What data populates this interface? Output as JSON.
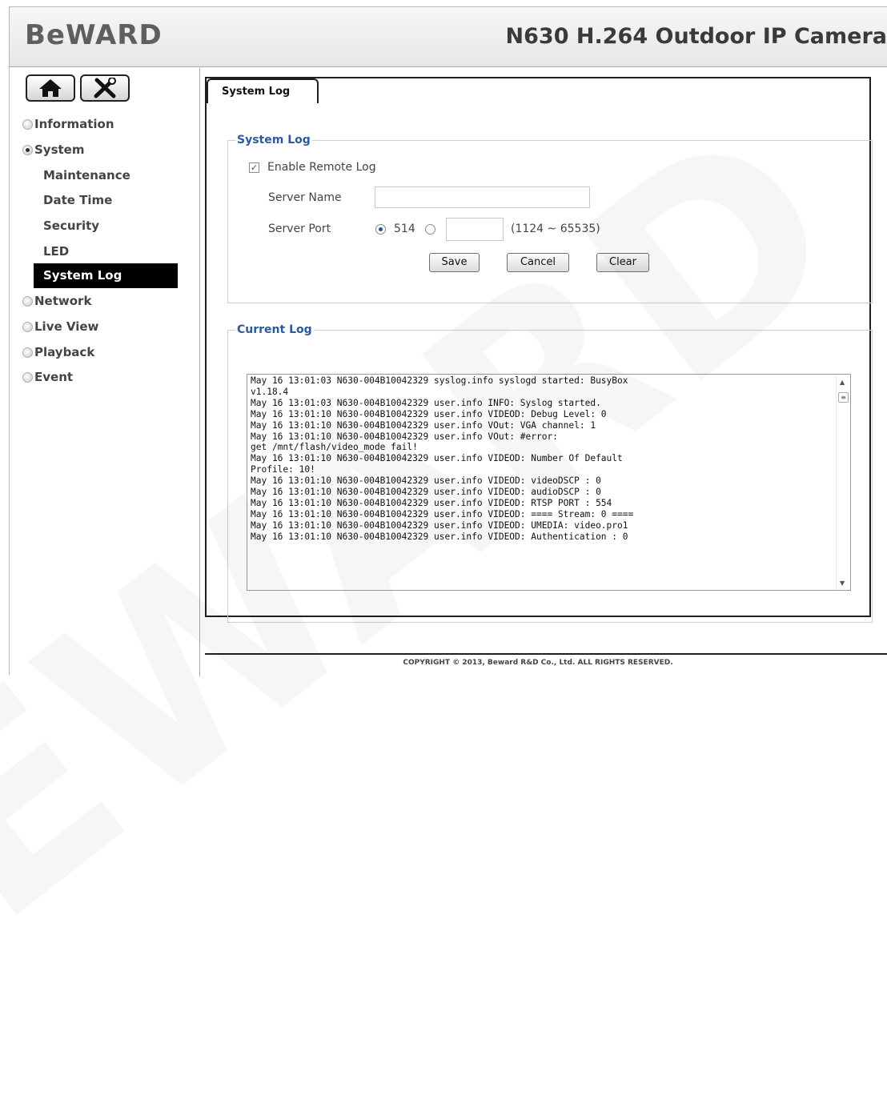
{
  "header": {
    "logo": "BeWARD",
    "camera_title": "N630 H.264 Outdoor IP Camera"
  },
  "sidebar": {
    "icons": [
      "home-icon",
      "tools-icon"
    ],
    "nav": [
      {
        "label": "Information",
        "expanded": false
      },
      {
        "label": "System",
        "expanded": true
      },
      {
        "label": "Network",
        "expanded": false
      },
      {
        "label": "Live View",
        "expanded": false
      },
      {
        "label": "Playback",
        "expanded": false
      },
      {
        "label": "Event",
        "expanded": false
      }
    ],
    "system_sub": [
      "Maintenance",
      "Date Time",
      "Security",
      "LED",
      "System Log"
    ],
    "active_sub": "System Log"
  },
  "tab": {
    "label": "System Log"
  },
  "system_log": {
    "legend": "System Log",
    "enable_remote_log_label": "Enable Remote Log",
    "enable_remote_log_checked": true,
    "server_name_label": "Server Name",
    "server_name_value": "",
    "server_port_label": "Server Port",
    "port_default_label": "514",
    "port_custom_value": "",
    "port_range_hint": "(1124 ~ 65535)",
    "buttons": {
      "save": "Save",
      "cancel": "Cancel",
      "clear": "Clear"
    }
  },
  "current_log": {
    "legend": "Current Log",
    "text": "May 16 13:01:03 N630-004B10042329 syslog.info syslogd started: BusyBox\nv1.18.4\nMay 16 13:01:03 N630-004B10042329 user.info INFO: Syslog started.\nMay 16 13:01:10 N630-004B10042329 user.info VIDEOD: Debug Level: 0\nMay 16 13:01:10 N630-004B10042329 user.info VOut: VGA channel: 1\nMay 16 13:01:10 N630-004B10042329 user.info VOut: #error:\nget /mnt/flash/video_mode fail!\nMay 16 13:01:10 N630-004B10042329 user.info VIDEOD: Number Of Default\nProfile: 10!\nMay 16 13:01:10 N630-004B10042329 user.info VIDEOD: videoDSCP : 0\nMay 16 13:01:10 N630-004B10042329 user.info VIDEOD: audioDSCP : 0\nMay 16 13:01:10 N630-004B10042329 user.info VIDEOD: RTSP PORT : 554\nMay 16 13:01:10 N630-004B10042329 user.info VIDEOD: ==== Stream: 0 ====\nMay 16 13:01:10 N630-004B10042329 user.info VIDEOD: UMEDIA: video.pro1\nMay 16 13:01:10 N630-004B10042329 user.info VIDEOD: Authentication : 0"
  },
  "footer": {
    "copyright": "COPYRIGHT © 2013, Beward R&D Co., Ltd. ALL RIGHTS RESERVED."
  },
  "watermark": "BEWARD"
}
